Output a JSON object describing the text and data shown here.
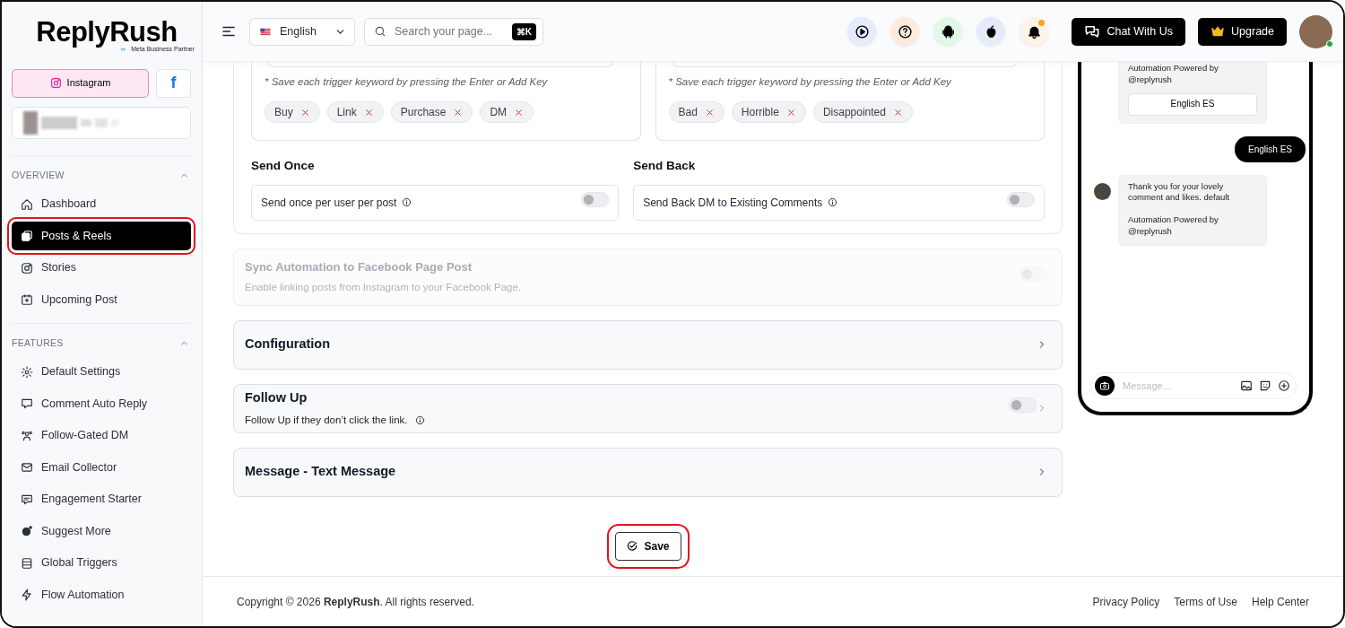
{
  "logo": {
    "name": "ReplyRush",
    "badge": "Meta Business Partner"
  },
  "platform_tabs": [
    {
      "kind": "instagram",
      "label": "Instagram",
      "selected": true
    },
    {
      "kind": "facebook",
      "glyph": "f",
      "selected": false
    }
  ],
  "sidebar": {
    "sections": [
      {
        "title": "OVERVIEW",
        "expanded": true,
        "items": [
          {
            "label": "Dashboard",
            "selected": false,
            "highlighted": false
          },
          {
            "label": "Posts & Reels",
            "selected": true,
            "highlighted": true
          },
          {
            "label": "Stories",
            "selected": false,
            "highlighted": false
          },
          {
            "label": "Upcoming Post",
            "selected": false,
            "highlighted": false
          }
        ]
      },
      {
        "title": "FEATURES",
        "expanded": true,
        "items": [
          {
            "label": "Default Settings",
            "selected": false,
            "highlighted": false
          },
          {
            "label": "Comment Auto Reply",
            "selected": false,
            "highlighted": false
          },
          {
            "label": "Follow-Gated DM",
            "selected": false,
            "highlighted": false
          },
          {
            "label": "Email Collector",
            "selected": false,
            "highlighted": false
          },
          {
            "label": "Engagement Starter",
            "selected": false,
            "highlighted": false
          },
          {
            "label": "Suggest More",
            "selected": false,
            "highlighted": false
          },
          {
            "label": "Global Triggers",
            "selected": false,
            "highlighted": false
          },
          {
            "label": "Flow Automation",
            "selected": false,
            "highlighted": false
          }
        ]
      }
    ]
  },
  "header": {
    "language": "English",
    "search_placeholder": "Search your page...",
    "shortcut": "⌘K",
    "notification_unread": true,
    "chat_button": "Chat With Us",
    "upgrade_button": "Upgrade",
    "avatar_online": true
  },
  "keyword_groups": [
    {
      "hint": "* Save each trigger keyword by pressing the Enter or Add Key",
      "chips": [
        "Buy",
        "Link",
        "Purchase",
        "DM"
      ]
    },
    {
      "hint": "* Save each trigger keyword by pressing the Enter or Add Key",
      "chips": [
        "Bad",
        "Horrible",
        "Disappointed"
      ]
    }
  ],
  "options": [
    {
      "title": "Send Once",
      "label": "Send once per user per post",
      "on": false
    },
    {
      "title": "Send Back",
      "label": "Send Back DM to Existing Comments",
      "on": false
    }
  ],
  "sync": {
    "title": "Sync Automation to Facebook Page Post",
    "description": "Enable linking posts from Instagram to your Facebook Page.",
    "on": false,
    "disabled": true
  },
  "sections": [
    {
      "kind": "collapsible",
      "title": "Configuration"
    },
    {
      "kind": "toggle",
      "title": "Follow Up",
      "subtitle": "Follow Up if they don’t click the link.",
      "on": false
    },
    {
      "kind": "collapsible",
      "title": "Message - Text Message"
    }
  ],
  "save_button": {
    "label": "Save",
    "highlighted": true
  },
  "preview": {
    "messages": [
      {
        "kind": "received",
        "avatar": false,
        "paragraphs": [
          "Automation Powered by @replyrush"
        ],
        "button": "English ES"
      },
      {
        "kind": "sent",
        "paragraphs": [
          "English ES"
        ]
      },
      {
        "kind": "received",
        "avatar": true,
        "paragraphs": [
          "Thank you for your lovely comment and likes. default",
          "Automation Powered by @replyrush"
        ]
      }
    ],
    "composer_placeholder": "Message..."
  },
  "footer": {
    "copyright": "Copyright © 2026 **ReplyRush**. All rights reserved.",
    "links": [
      "Privacy Policy",
      "Terms of Use",
      "Help Center"
    ]
  }
}
